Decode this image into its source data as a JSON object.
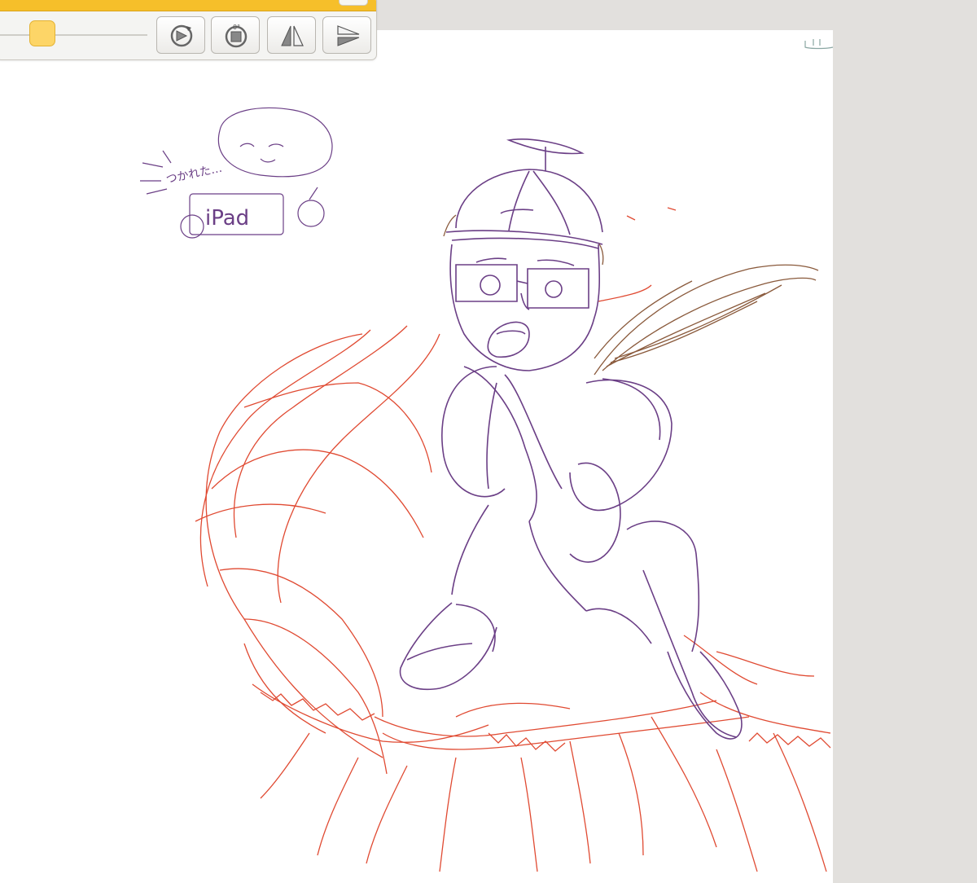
{
  "toolbar": {
    "accent_color": "#f6bf2a",
    "slider_thumb_color": "#fdd567",
    "buttons": [
      {
        "icon": "rotate-reset-icon",
        "interactable": true
      },
      {
        "icon": "rotate-zero-icon",
        "interactable": true
      },
      {
        "icon": "flip-horizontal-icon",
        "interactable": true
      },
      {
        "icon": "flip-vertical-icon",
        "interactable": true
      }
    ]
  },
  "canvas": {
    "background": "#ffffff",
    "sketch_note": {
      "sound_text": "つかれた…",
      "device_label": "iPad"
    },
    "line_colors": {
      "purple": "#6b3f86",
      "red": "#e04a32",
      "brown": "#8a5a3c"
    }
  }
}
